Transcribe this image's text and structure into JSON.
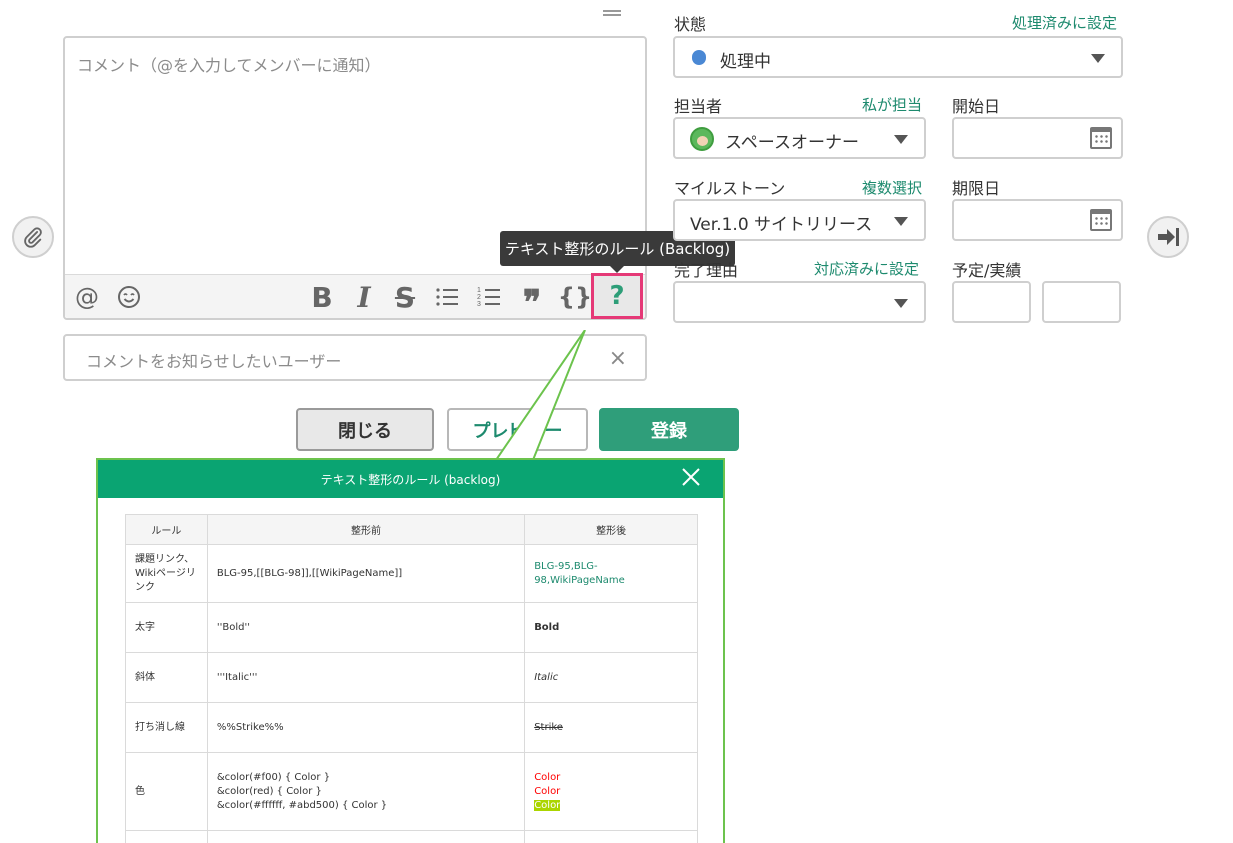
{
  "editor": {
    "placeholder": "コメント（@を入力してメンバーに通知）",
    "tooltip": "テキスト整形のルール (Backlog)",
    "toolbar": {
      "mention": "@",
      "bold": "B",
      "italic": "I",
      "strike": "S",
      "quote": "❞",
      "code": "{}",
      "help": "?"
    }
  },
  "notify": {
    "placeholder": "コメントをお知らせしたいユーザー",
    "clear": "×"
  },
  "buttons": {
    "close": "閉じる",
    "preview": "プレビュー",
    "submit": "登録"
  },
  "properties": {
    "status": {
      "label": "状態",
      "link": "処理済みに設定",
      "value": "処理中",
      "dot_color": "#4a88d4"
    },
    "assignee": {
      "label": "担当者",
      "link": "私が担当",
      "value": "スペースオーナー"
    },
    "start_date": {
      "label": "開始日",
      "value": ""
    },
    "milestone": {
      "label": "マイルストーン",
      "link": "複数選択",
      "value": "Ver.1.0 サイトリリース"
    },
    "due_date": {
      "label": "期限日",
      "value": ""
    },
    "resolution": {
      "label": "完了理由",
      "link": "対応済みに設定",
      "value": ""
    },
    "hours": {
      "label": "予定/実績",
      "estimated": "",
      "actual": ""
    }
  },
  "dialog": {
    "title": "テキスト整形のルール (backlog)",
    "columns": [
      "ルール",
      "整形前",
      "整形後"
    ],
    "rows": [
      {
        "rule": "課題リンク、Wikiページリンク",
        "before": "BLG-95,[[BLG-98]],[[WikiPageName]]",
        "after": "BLG-95,BLG-98,WikiPageName"
      },
      {
        "rule": "太字",
        "before": "''Bold''",
        "after": "Bold"
      },
      {
        "rule": "斜体",
        "before": "'''Italic'''",
        "after": "Italic"
      },
      {
        "rule": "打ち消し線",
        "before": "%%Strike%%",
        "after": "Strike"
      },
      {
        "rule": "色",
        "before": [
          "&color(#f00) { Color }",
          "&color(red) { Color }",
          "&color(#ffffff, #abd500) { Color }"
        ],
        "after": [
          "Color",
          "Color",
          "Color"
        ]
      }
    ]
  },
  "colors": {
    "accent": "#2f9e7a",
    "dialog_header": "#0aa472",
    "help_highlight": "#e53977",
    "link": "#1d8a6e"
  }
}
